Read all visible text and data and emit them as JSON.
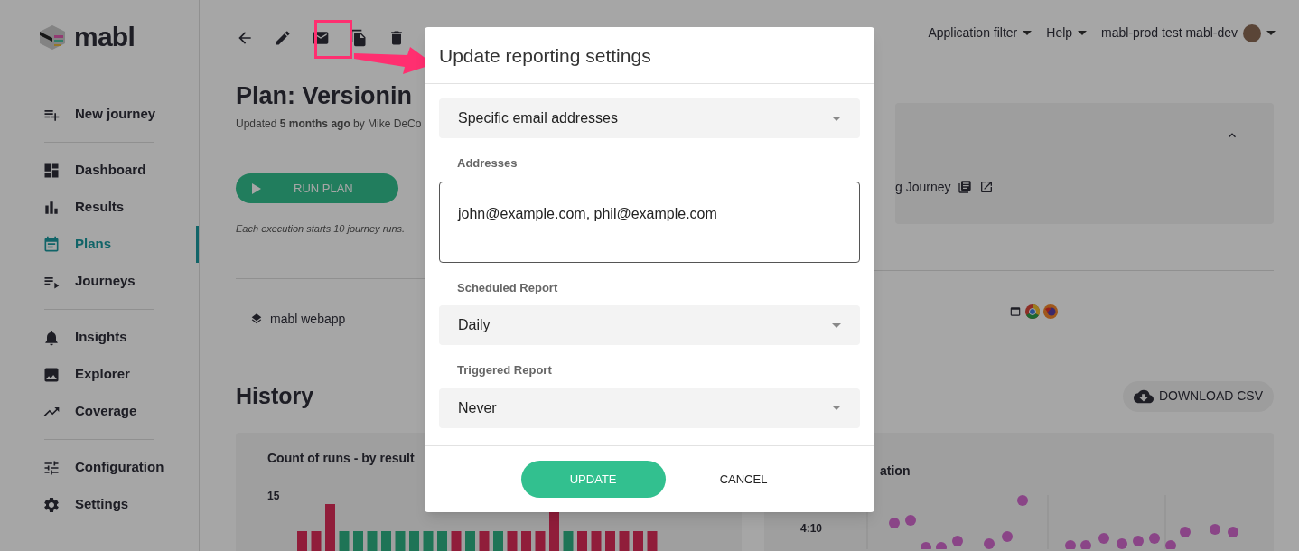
{
  "sidebar": {
    "logo": "mabl",
    "groups": [
      {
        "items": [
          {
            "kind": "new",
            "label": "New journey",
            "selected": false
          }
        ]
      },
      {
        "items": [
          {
            "kind": "dashboard",
            "label": "Dashboard",
            "selected": false
          },
          {
            "kind": "results",
            "label": "Results",
            "selected": false
          },
          {
            "kind": "plans",
            "label": "Plans",
            "selected": true
          },
          {
            "kind": "journeys",
            "label": "Journeys",
            "selected": false
          }
        ]
      },
      {
        "items": [
          {
            "kind": "insights",
            "label": "Insights",
            "selected": false
          },
          {
            "kind": "explorer",
            "label": "Explorer",
            "selected": false
          },
          {
            "kind": "coverage",
            "label": "Coverage",
            "selected": false
          }
        ]
      },
      {
        "items": [
          {
            "kind": "configuration",
            "label": "Configuration",
            "selected": false
          },
          {
            "kind": "settings",
            "label": "Settings",
            "selected": false
          }
        ]
      }
    ]
  },
  "header": {
    "menus": [
      "Application filter",
      "Help",
      "mabl-prod test mabl-dev"
    ]
  },
  "plan": {
    "title": "Plan: Versionin",
    "updated": "Updated **5 months ago** by Mike DeCo",
    "run_button": "RUN PLAN",
    "note": "Each execution starts 10 journey runs.",
    "application": "mabl webapp",
    "journey": "g Journey"
  },
  "history": {
    "title": "History",
    "download": "DOWNLOAD CSV",
    "chart_left": {
      "title": "Count of runs - by result",
      "y_tick": "15"
    },
    "chart_right": {
      "title": "ation",
      "y_tick": "4:10"
    }
  },
  "dialog": {
    "title": "Update reporting settings",
    "recipients": "Specific email addresses",
    "addresses_label": "Addresses",
    "addresses": "john@example.com, phil@example.com",
    "scheduled_label": "Scheduled Report",
    "scheduled": "Daily",
    "triggered_label": "Triggered Report",
    "triggered": "Never",
    "buttons": [
      "UPDATE",
      "CANCEL"
    ]
  }
}
